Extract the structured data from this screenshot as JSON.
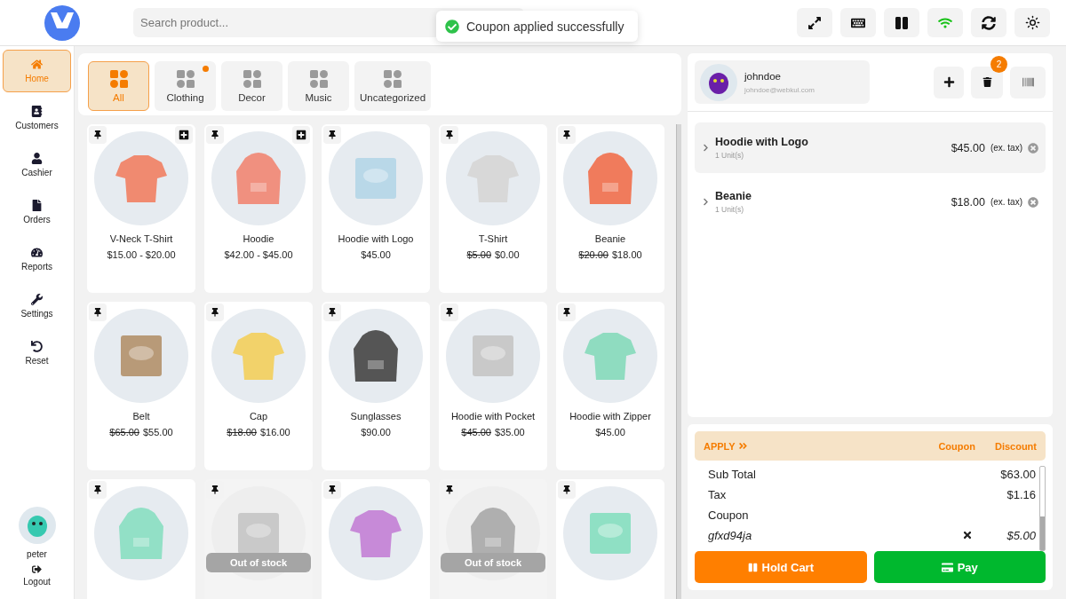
{
  "search": {
    "placeholder": "Search product..."
  },
  "toast": {
    "message": "Coupon applied successfully"
  },
  "toolbar": [
    {
      "kind": "expand"
    },
    {
      "kind": "keyboard"
    },
    {
      "kind": "pause"
    },
    {
      "kind": "wifi",
      "on": true
    },
    {
      "kind": "sync"
    },
    {
      "kind": "settings"
    }
  ],
  "sidebar": {
    "items": [
      {
        "label": "Home",
        "kind": "home",
        "selected": true
      },
      {
        "label": "Customers",
        "kind": "customers",
        "selected": false
      },
      {
        "label": "Cashier",
        "kind": "cashier",
        "selected": false
      },
      {
        "label": "Orders",
        "kind": "orders",
        "selected": false
      },
      {
        "label": "Reports",
        "kind": "reports",
        "selected": false
      },
      {
        "label": "Settings",
        "kind": "settings",
        "selected": false
      },
      {
        "label": "Reset",
        "kind": "reset",
        "selected": false
      }
    ],
    "user": {
      "name": "peter"
    },
    "logout": {
      "label": "Logout"
    }
  },
  "categories": [
    {
      "label": "All",
      "selected": true,
      "notification": false
    },
    {
      "label": "Clothing",
      "selected": false,
      "notification": true
    },
    {
      "label": "Decor",
      "selected": false,
      "notification": false
    },
    {
      "label": "Music",
      "selected": false,
      "notification": false
    },
    {
      "label": "Uncategorized",
      "selected": false,
      "notification": false
    }
  ],
  "products": [
    {
      "name": "V-Neck T-Shirt",
      "price": "$15.00 - $20.00",
      "addable": true
    },
    {
      "name": "Hoodie",
      "price": "$42.00 - $45.00",
      "addable": true
    },
    {
      "name": "Hoodie with Logo",
      "price": "$45.00",
      "addable": false
    },
    {
      "name": "T-Shirt",
      "old_price": "$5.00",
      "price": "$0.00",
      "addable": false
    },
    {
      "name": "Beanie",
      "old_price": "$20.00",
      "price": "$18.00",
      "addable": false
    },
    {
      "name": "Belt",
      "old_price": "$65.00",
      "price": "$55.00",
      "addable": false
    },
    {
      "name": "Cap",
      "old_price": "$18.00",
      "price": "$16.00",
      "addable": false
    },
    {
      "name": "Sunglasses",
      "price": "$90.00",
      "addable": false
    },
    {
      "name": "Hoodie with Pocket",
      "old_price": "$45.00",
      "price": "$35.00",
      "addable": false
    },
    {
      "name": "Hoodie with Zipper",
      "price": "$45.00",
      "addable": false
    },
    {
      "addable": false
    },
    {
      "addable": false,
      "badge": "Out of stock"
    },
    {
      "addable": false
    },
    {
      "addable": false,
      "badge": "Out of stock"
    },
    {
      "addable": false
    }
  ],
  "cart": {
    "customer": {
      "name": "johndoe",
      "email": "johndoe@webkul.com"
    },
    "item_count": "2",
    "items": [
      {
        "name": "Hoodie with Logo",
        "units": "1 Unit(s)",
        "price": "$45.00",
        "tax_note": "(ex. tax)",
        "selected": true
      },
      {
        "name": "Beanie",
        "units": "1 Unit(s)",
        "price": "$18.00",
        "tax_note": "(ex. tax)",
        "selected": false
      }
    ],
    "apply": {
      "label": "APPLY",
      "links": [
        "Coupon",
        "Discount"
      ]
    },
    "totals": [
      {
        "label": "Sub Total",
        "value": "$63.00"
      },
      {
        "label": "Tax",
        "value": "$1.16"
      },
      {
        "label": "Coupon"
      }
    ],
    "coupon": {
      "code": "gfxd94ja",
      "amount": "$5.00"
    },
    "hold_button": "Hold Cart",
    "pay_button": "Pay"
  }
}
